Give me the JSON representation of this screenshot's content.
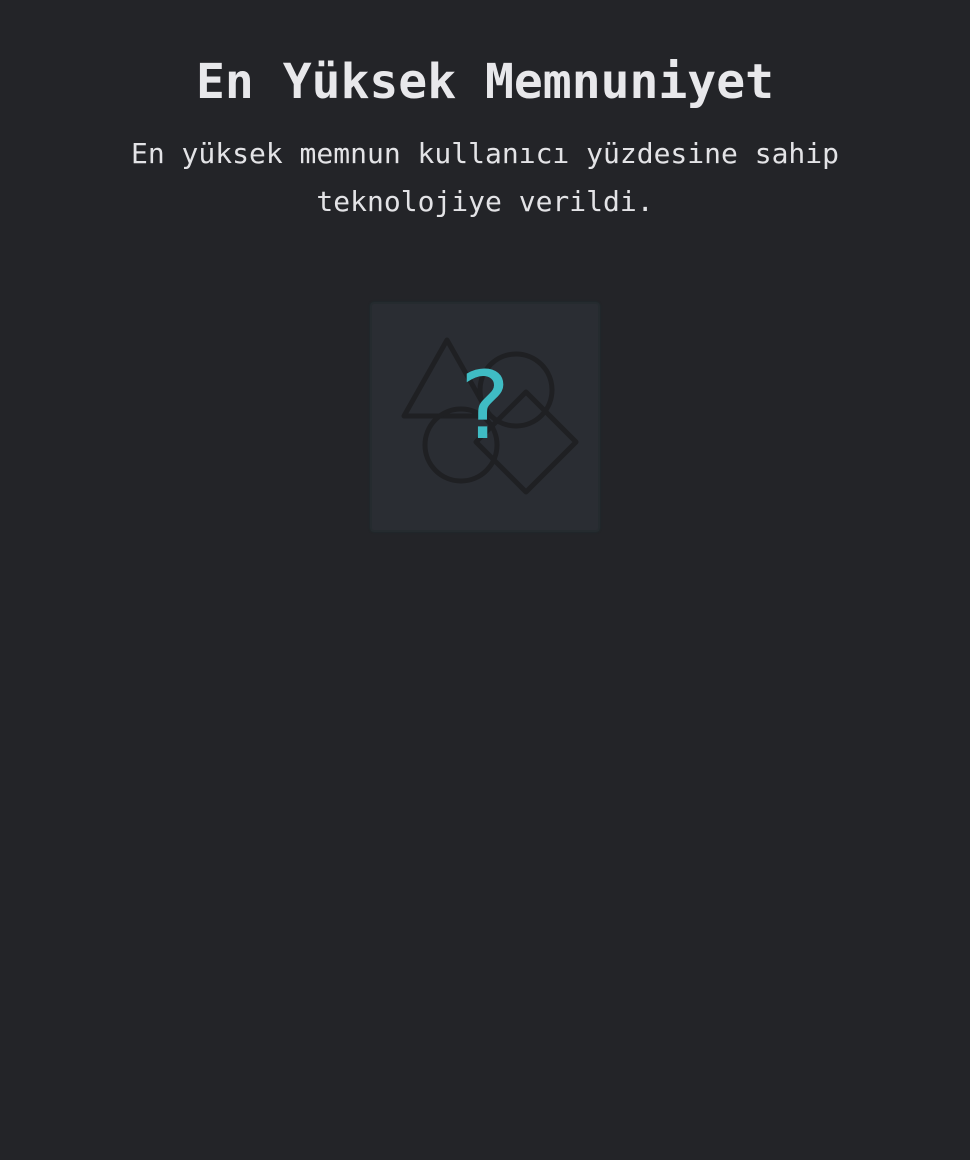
{
  "header": {
    "title": "En Yüksek Memnuniyet",
    "description": "En yüksek memnun kullanıcı yüzdesine sahip teknolojiye verildi."
  },
  "award_badge": {
    "icon": "question-mark-shapes-icon",
    "symbol": "?",
    "accent_color": "#3fbcc4"
  },
  "theme": {
    "background": "#232428",
    "card_background": "#2a2d33"
  }
}
